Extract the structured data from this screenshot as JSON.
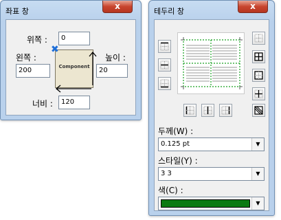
{
  "coord_window": {
    "title": "좌표 창",
    "close_label": "x",
    "top_label": "위쪽 :",
    "top_value": "0",
    "left_label": "왼쪽 :",
    "left_value": "200",
    "height_label": "높이 :",
    "height_value": "20",
    "width_label": "너비 :",
    "width_value": "120",
    "component_label": "Component"
  },
  "border_window": {
    "title": "테두리 창",
    "close_label": "x",
    "thickness_label": "두께(W) :",
    "thickness_value": "0.125 pt",
    "style_label": "스타일(Y) :",
    "style_value": "3 3",
    "color_label": "색(C) :",
    "color_value": "#0b7a12"
  }
}
